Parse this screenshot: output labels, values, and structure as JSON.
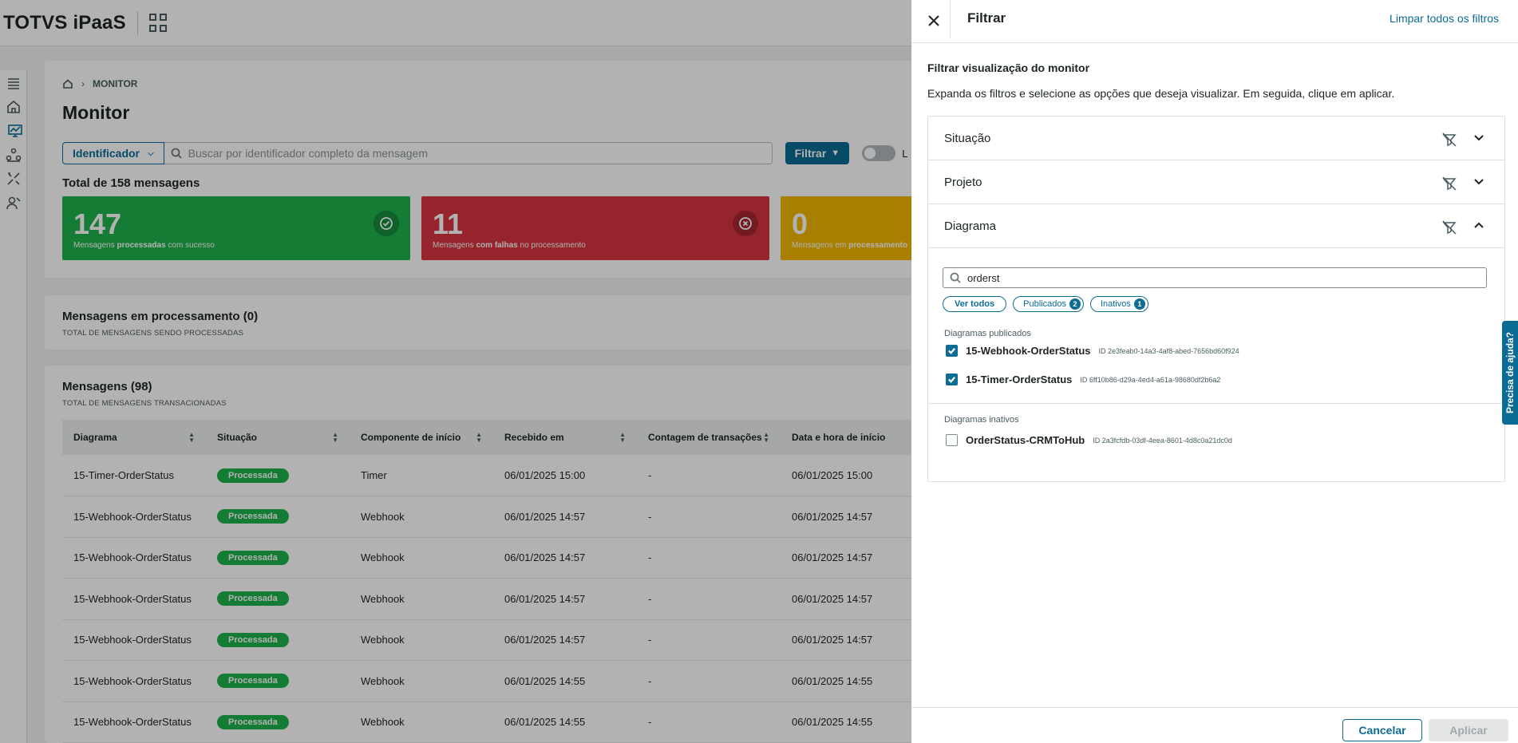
{
  "app": {
    "brand": "TOTVS iPaaS"
  },
  "breadcrumb": {
    "current": "MONITOR"
  },
  "page": {
    "title": "Monitor"
  },
  "search": {
    "identifier_label": "Identificador",
    "placeholder": "Buscar por identificador completo da mensagem",
    "filter_label": "Filtrar",
    "toggle_partial": "L"
  },
  "summary": {
    "total": "Total de 158 mensagens",
    "success": {
      "value": "147",
      "pre": "Mensagens ",
      "bold": "processadas",
      "post": " com sucesso"
    },
    "failed": {
      "value": "11",
      "pre": "Mensagens ",
      "bold": "com falhas",
      "post": " no processamento"
    },
    "processing": {
      "value": "0",
      "pre": "Mensagens em ",
      "bold": "processamento",
      "post": ""
    }
  },
  "processing_section": {
    "title": "Mensagens em processamento (0)",
    "subtitle": "TOTAL DE MENSAGENS SENDO PROCESSADAS"
  },
  "messages_section": {
    "title": "Mensagens (98)",
    "subtitle": "TOTAL DE MENSAGENS TRANSACIONADAS",
    "columns": [
      "Diagrama",
      "Situação",
      "Componente de início",
      "Recebido em",
      "Contagem de transações",
      "Data e hora de início"
    ],
    "rows": [
      [
        "15-Timer-OrderStatus",
        "Processada",
        "Timer",
        "06/01/2025 15:00",
        "-",
        "06/01/2025 15:00"
      ],
      [
        "15-Webhook-OrderStatus",
        "Processada",
        "Webhook",
        "06/01/2025 14:57",
        "-",
        "06/01/2025 14:57"
      ],
      [
        "15-Webhook-OrderStatus",
        "Processada",
        "Webhook",
        "06/01/2025 14:57",
        "-",
        "06/01/2025 14:57"
      ],
      [
        "15-Webhook-OrderStatus",
        "Processada",
        "Webhook",
        "06/01/2025 14:57",
        "-",
        "06/01/2025 14:57"
      ],
      [
        "15-Webhook-OrderStatus",
        "Processada",
        "Webhook",
        "06/01/2025 14:57",
        "-",
        "06/01/2025 14:57"
      ],
      [
        "15-Webhook-OrderStatus",
        "Processada",
        "Webhook",
        "06/01/2025 14:55",
        "-",
        "06/01/2025 14:55"
      ],
      [
        "15-Webhook-OrderStatus",
        "Processada",
        "Webhook",
        "06/01/2025 14:55",
        "-",
        "06/01/2025 14:55"
      ]
    ]
  },
  "drawer": {
    "title": "Filtrar",
    "clear_all": "Limpar todos os filtros",
    "subtitle": "Filtrar visualização do monitor",
    "instructions": "Expanda os filtros e selecione as opções que deseja visualizar. Em seguida, clique em aplicar.",
    "sections": [
      "Situação",
      "Projeto",
      "Diagrama"
    ],
    "diagram_filter": {
      "search_value": "orderst",
      "chips": {
        "all": "Ver todos",
        "published": "Publicados",
        "published_count": "2",
        "inactive": "Inativos",
        "inactive_count": "1"
      },
      "published_label": "Diagramas publicados",
      "inactive_label": "Diagramas inativos",
      "published": [
        {
          "name": "15-Webhook-OrderStatus",
          "id": "ID 2e3feab0-14a3-4af8-abed-7656bd60f924",
          "checked": true
        },
        {
          "name": "15-Timer-OrderStatus",
          "id": "ID 6ff10b86-d29a-4ed4-a61a-98680df2b6a2",
          "checked": true
        }
      ],
      "inactive": [
        {
          "name": "OrderStatus-CRMToHub",
          "id": "ID 2a3fcfdb-03df-4eea-8601-4d8c0a21dc0d",
          "checked": false
        }
      ]
    },
    "cancel": "Cancelar",
    "apply": "Aplicar"
  },
  "help": {
    "label": "Precisa de ajuda?"
  },
  "colors": {
    "primary": "#0c6c94",
    "success": "#1db24c",
    "danger": "#d6343f",
    "warning": "#f1b700"
  },
  "icons": [
    "apps-icon",
    "menu-icon",
    "home-icon",
    "monitor-icon",
    "network-icon",
    "tools-icon",
    "users-icon",
    "search-icon",
    "filter-icon",
    "check-circle-icon",
    "error-circle-icon",
    "close-icon",
    "no-filter-icon",
    "chevron-down-icon",
    "chevron-up-icon"
  ]
}
